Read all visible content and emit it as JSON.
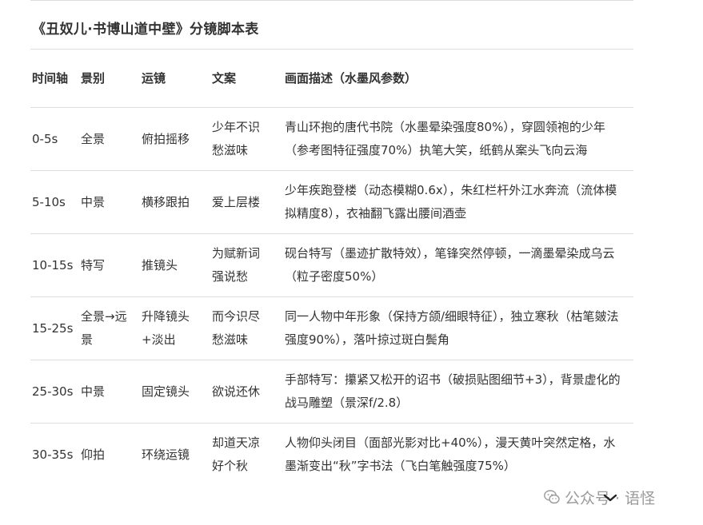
{
  "document": {
    "title": "《丑奴儿·书博山道中壁》分镜脚本表"
  },
  "table": {
    "headers": {
      "time": "时间轴",
      "shot": "景别",
      "camera": "运镜",
      "copy": "文案",
      "description": "画面描述（水墨风参数）"
    },
    "rows": [
      {
        "time": "0-5s",
        "shot": "全景",
        "camera": "俯拍摇移",
        "copy": "少年不识愁滋味",
        "description": "青山环抱的唐代书院（水墨晕染强度80%），穿圆领袍的少年（参考图特征强度70%）执笔大笑，纸鹤从案头飞向云海"
      },
      {
        "time": "5-10s",
        "shot": "中景",
        "camera": "横移跟拍",
        "copy": "爱上层楼",
        "description": "少年疾跑登楼（动态模糊0.6x），朱红栏杆外江水奔流（流体模拟精度8），衣袖翻飞露出腰间酒壶"
      },
      {
        "time": "10-15s",
        "shot": "特写",
        "camera": "推镜头",
        "copy": "为赋新词强说愁",
        "description": "砚台特写（墨迹扩散特效），笔锋突然停顿，一滴墨晕染成乌云（粒子密度50%）"
      },
      {
        "time": "15-25s",
        "shot": "全景→远景",
        "camera": "升降镜头+淡出",
        "copy": "而今识尽愁滋味",
        "description": "同一人物中年形象（保持方颌/细眼特征），独立寒秋（枯笔皴法强度90%），落叶掠过斑白鬓角"
      },
      {
        "time": "25-30s",
        "shot": "中景",
        "camera": "固定镜头",
        "copy": "欲说还休",
        "description": "手部特写：攥紧又松开的诏书（破损贴图细节+3），背景虚化的战马雕塑（景深f/2.8）"
      },
      {
        "time": "30-35s",
        "shot": "仰拍",
        "camera": "环绕运镜",
        "copy": "却道天凉好个秋",
        "description": "人物仰头闭目（面部光影对比+40%），漫天黄叶突然定格，水墨渐变出“秋”字书法（飞白笔触强度75%）"
      }
    ]
  },
  "watermark": {
    "text": "公众号 · 语怪",
    "icon": "wechat-icon"
  },
  "collapse": {
    "icon": "chevron-down-icon"
  }
}
